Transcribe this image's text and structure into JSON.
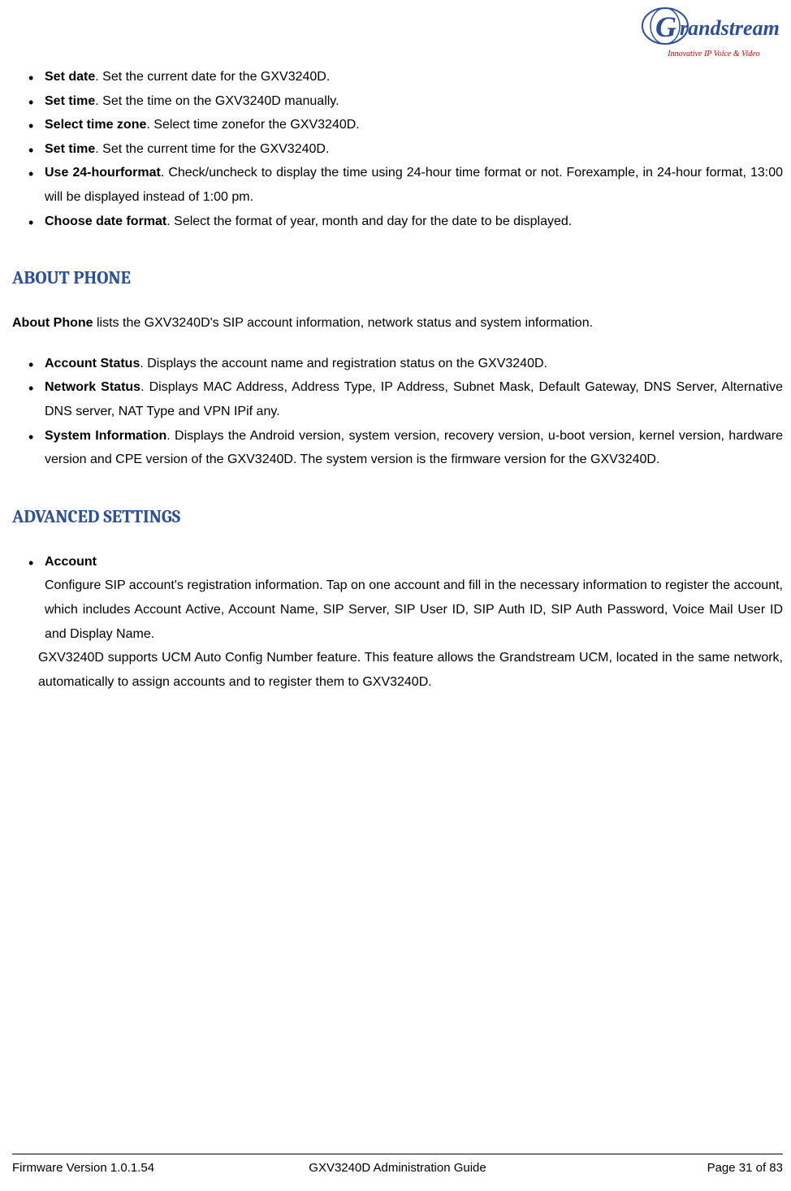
{
  "logo": {
    "brand_g": "G",
    "brand_rest": "randstream",
    "tagline": "Innovative IP Voice & Video"
  },
  "list1": [
    {
      "term": "Set date",
      "desc": ". Set the current date for the GXV3240D."
    },
    {
      "term": "Set time",
      "desc": ". Set the time on the GXV3240D manually."
    },
    {
      "term": "Select time zone",
      "desc": ". Select time zonefor the GXV3240D."
    },
    {
      "term": "Set time",
      "desc": ". Set the current time for the GXV3240D."
    },
    {
      "term": "Use 24-hourformat",
      "desc": ". Check/uncheck to display the time using 24-hour time format or not. Forexample, in 24-hour format, 13:00 will be displayed instead of 1:00 pm."
    },
    {
      "term": "Choose date format",
      "desc": ". Select the format of year, month and day for the date to be displayed."
    }
  ],
  "heading1": "ABOUT PHONE",
  "intro1_bold": "About Phone",
  "intro1_rest": " lists the GXV3240D's SIP account information, network status and system information.",
  "list2": [
    {
      "term": "Account Status",
      "desc": ". Displays the account name and registration status on the GXV3240D."
    },
    {
      "term": "Network Status",
      "desc": ". Displays MAC Address, Address Type, IP Address, Subnet Mask, Default Gateway, DNS Server, Alternative DNS server, NAT Type and VPN IPif any."
    },
    {
      "term": "System Information",
      "desc": ". Displays the Android version, system version, recovery version, u-boot version, kernel version, hardware version and CPE version of the GXV3240D. The system version is the firmware version for the GXV3240D."
    }
  ],
  "heading2": "ADVANCED SETTINGS",
  "list3": {
    "term": "Account",
    "body": "Configure SIP account's registration information. Tap on one account and fill in the necessary information to register the account, which includes Account Active, Account Name, SIP Server, SIP User ID, SIP Auth ID, SIP Auth Password, Voice Mail User ID and Display Name."
  },
  "extra_para": "GXV3240D supports UCM Auto Config Number feature. This feature allows the Grandstream UCM, located in the same network, automatically to assign accounts and to register them to GXV3240D.",
  "footer": {
    "left": "Firmware Version 1.0.1.54",
    "center": "GXV3240D Administration Guide",
    "right": "Page 31 of 83"
  }
}
